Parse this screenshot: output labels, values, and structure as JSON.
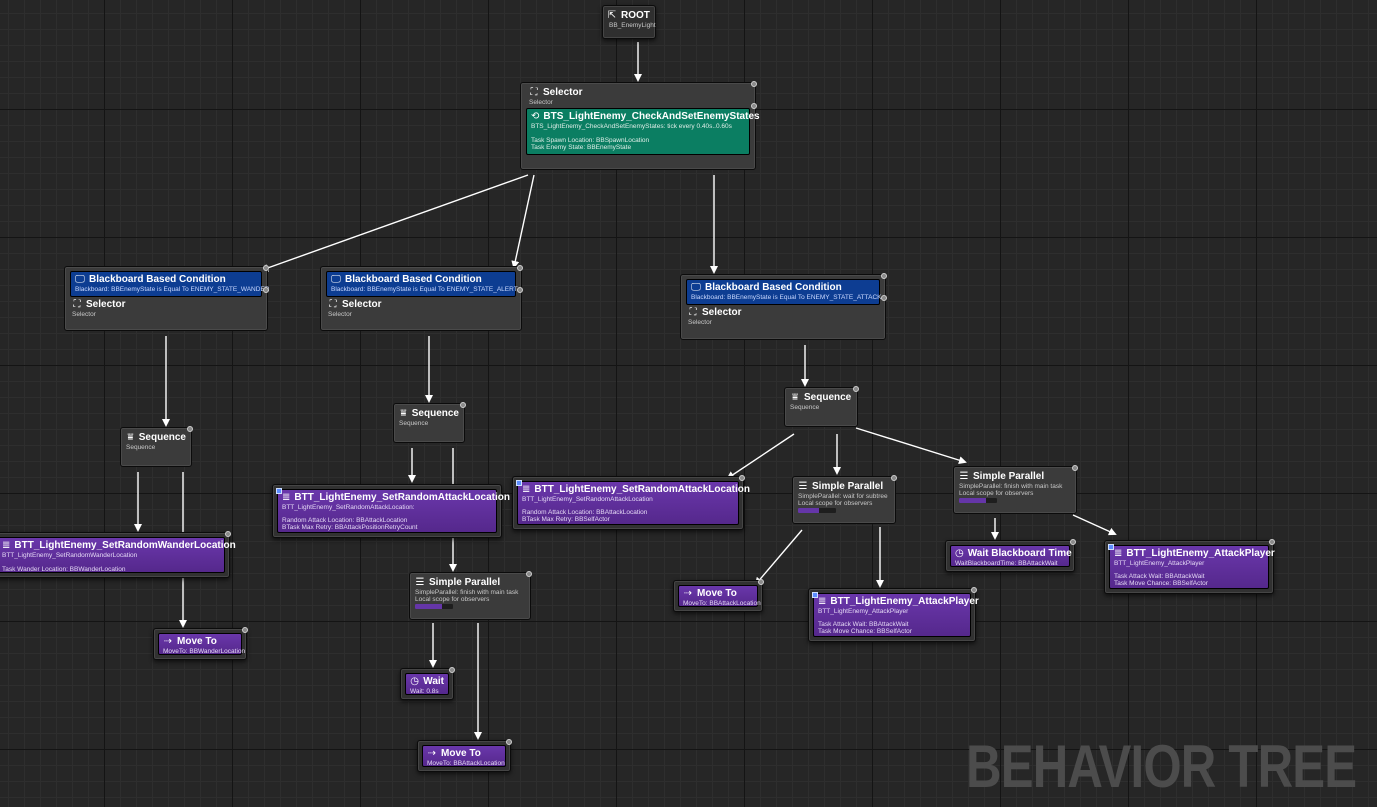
{
  "app": {
    "watermark": "BEHAVIOR TREE"
  },
  "colors": {
    "decorator": "#0d3d92",
    "service": "#0b7e62",
    "task": "#5e2f9a",
    "composite": "#3b3b3b",
    "wire": "#ffffff"
  },
  "nodes": {
    "root": {
      "icon": "root-icon",
      "title": "ROOT",
      "sub": "BB_EnemyLight"
    },
    "main_selector": {
      "icon": "selector-icon",
      "title": "Selector",
      "sub": "Selector",
      "service": {
        "icon": "service-icon",
        "title": "BTS_LightEnemy_CheckAndSetEnemyStates",
        "lines": [
          "BTS_LightEnemy_CheckAndSetEnemyStates: tick every 0.40s..0.60s",
          "",
          "Task Spawn Location: BBSpawnLocation",
          "Task Enemy State: BBEnemyState"
        ]
      }
    },
    "wander": {
      "decorator": {
        "icon": "blackboard-icon",
        "title": "Blackboard Based Condition",
        "sub": "Blackboard: BBEnemyState is Equal To ENEMY_STATE_WANDER"
      },
      "composite": {
        "icon": "selector-icon",
        "title": "Selector",
        "sub": "Selector"
      },
      "sequence": {
        "icon": "sequence-icon",
        "title": "Sequence",
        "sub": "Sequence"
      },
      "task_setwander": {
        "icon": "task-icon",
        "title": "BTT_LightEnemy_SetRandomWanderLocation",
        "lines": [
          "BTT_LightEnemy_SetRandomWanderLocation",
          "",
          "Task Wander Location: BBWanderLocation"
        ]
      },
      "move_to": {
        "icon": "move-to-icon",
        "title": "Move To",
        "lines": [
          "MoveTo: BBWanderLocation"
        ]
      }
    },
    "alert": {
      "decorator": {
        "icon": "blackboard-icon",
        "title": "Blackboard Based Condition",
        "sub": "Blackboard: BBEnemyState is Equal To ENEMY_STATE_ALERT"
      },
      "composite": {
        "icon": "selector-icon",
        "title": "Selector",
        "sub": "Selector"
      },
      "sequence": {
        "icon": "sequence-icon",
        "title": "Sequence",
        "sub": "Sequence"
      },
      "task_setattack": {
        "icon": "task-icon",
        "title": "BTT_LightEnemy_SetRandomAttackLocation",
        "lines": [
          "BTT_LightEnemy_SetRandomAttackLocation:",
          "",
          "Random Attack Location: BBAttackLocation",
          "BTask Max Retry: BBAttackPositionRetryCount"
        ]
      },
      "parallel": {
        "icon": "parallel-icon",
        "title": "Simple Parallel",
        "lines": [
          "SimpleParallel: finish with main task",
          "Local scope for observers"
        ],
        "progress": 0.7
      },
      "wait": {
        "icon": "wait-icon",
        "title": "Wait",
        "lines": [
          "Wait: 0.8s"
        ]
      },
      "move_to": {
        "icon": "move-to-icon",
        "title": "Move To",
        "lines": [
          "MoveTo: BBAttackLocation"
        ]
      },
      "task_setattack2": {
        "icon": "task-icon",
        "title": "BTT_LightEnemy_SetRandomAttackLocation",
        "lines": [
          "BTT_LightEnemy_SetRandomAttackLocation",
          "",
          "Random Attack Location: BBAttackLocation",
          "BTask Max Retry: BBSelfActor"
        ]
      }
    },
    "attack": {
      "decorator": {
        "icon": "blackboard-icon",
        "title": "Blackboard Based Condition",
        "sub": "Blackboard: BBEnemyState is Equal To ENEMY_STATE_ATTACK"
      },
      "composite": {
        "icon": "selector-icon",
        "title": "Selector",
        "sub": "Selector"
      },
      "sequence": {
        "icon": "sequence-icon",
        "title": "Sequence",
        "sub": "Sequence"
      },
      "parallel_a": {
        "icon": "parallel-icon",
        "title": "Simple Parallel",
        "lines": [
          "SimpleParallel: wait for subtree",
          "Local scope for observers"
        ],
        "progress": 0.55
      },
      "move_to": {
        "icon": "move-to-icon",
        "title": "Move To",
        "lines": [
          "MoveTo: BBAttackLocation"
        ]
      },
      "attack_player_a": {
        "icon": "task-icon",
        "title": "BTT_LightEnemy_AttackPlayer",
        "lines": [
          "BTT_LightEnemy_AttackPlayer",
          "",
          "Task Attack Wait: BBAttackWait",
          "Task Move Chance: BBSelfActor"
        ]
      },
      "parallel_b": {
        "icon": "parallel-icon",
        "title": "Simple Parallel",
        "lines": [
          "SimpleParallel: finish with main task",
          "Local scope for observers"
        ],
        "progress": 0.7
      },
      "wait_bb": {
        "icon": "wait-icon",
        "title": "Wait Blackboard Time",
        "lines": [
          "WaitBlackboardTime: BBAttackWait"
        ]
      },
      "attack_player_b": {
        "icon": "task-icon",
        "title": "BTT_LightEnemy_AttackPlayer",
        "lines": [
          "BTT_LightEnemy_AttackPlayer",
          "",
          "Task Attack Wait: BBAttackWait",
          "Task Move Chance: BBSelfActor"
        ]
      }
    }
  }
}
